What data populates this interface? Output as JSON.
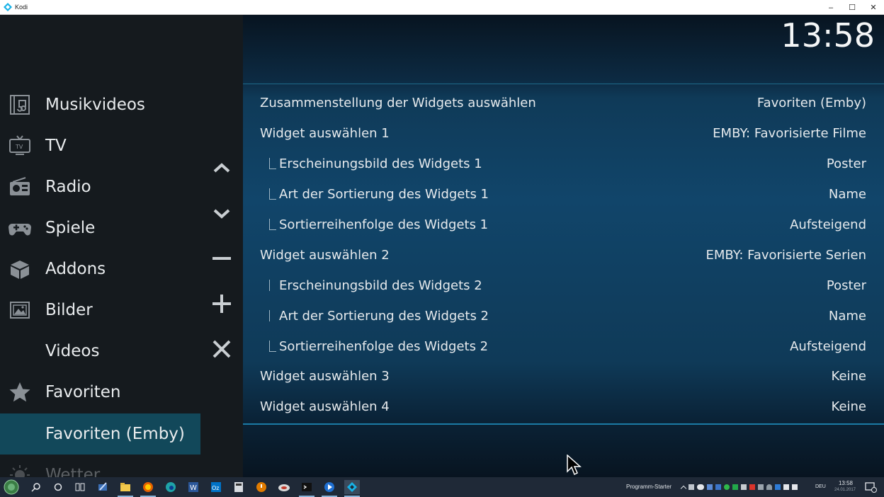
{
  "window": {
    "title": "Kodi",
    "minimize": "–",
    "maximize": "☐",
    "close": "✕"
  },
  "clock": "13:58",
  "sidebar": {
    "items": [
      {
        "label": "Musikvideos",
        "icon": "music-video-icon"
      },
      {
        "label": "TV",
        "icon": "tv-icon"
      },
      {
        "label": "Radio",
        "icon": "radio-icon"
      },
      {
        "label": "Spiele",
        "icon": "gamepad-icon"
      },
      {
        "label": "Addons",
        "icon": "addons-box-icon"
      },
      {
        "label": "Bilder",
        "icon": "pictures-icon"
      },
      {
        "label": "Videos",
        "icon": ""
      },
      {
        "label": "Favoriten",
        "icon": "star-icon"
      },
      {
        "label": "Favoriten (Emby)",
        "icon": ""
      },
      {
        "label": "Wetter",
        "icon": "weather-icon"
      }
    ],
    "active_index": 8
  },
  "side_controls": [
    "move-up",
    "move-down",
    "remove",
    "add",
    "close"
  ],
  "settings": {
    "rows": [
      {
        "label": "Zusammenstellung der Widgets auswählen",
        "value": "Favoriten (Emby)",
        "level": 0
      },
      {
        "label": "Widget auswählen 1",
        "value": "EMBY: Favorisierte Filme",
        "level": 0
      },
      {
        "label": "Erscheinungsbild des Widgets 1",
        "value": "Poster",
        "level": 1
      },
      {
        "label": "Art der Sortierung des Widgets 1",
        "value": "Name",
        "level": 1
      },
      {
        "label": "Sortierreihenfolge des Widgets 1",
        "value": "Aufsteigend",
        "level": 1
      },
      {
        "label": "Widget auswählen 2",
        "value": "EMBY: Favorisierte Serien",
        "level": 0
      },
      {
        "label": "Erscheinungsbild des Widgets 2",
        "value": "Poster",
        "level": 1
      },
      {
        "label": "Art der Sortierung des Widgets 2",
        "value": "Name",
        "level": 1
      },
      {
        "label": "Sortierreihenfolge des Widgets 2",
        "value": "Aufsteigend",
        "level": 1
      },
      {
        "label": "Widget auswählen 3",
        "value": "Keine",
        "level": 0
      },
      {
        "label": "Widget auswählen 4",
        "value": "Keine",
        "level": 0
      }
    ]
  },
  "taskbar": {
    "starter": "Programm-Starter",
    "lang": "DEU",
    "time": "13:58",
    "date": "24.01.2017"
  },
  "colors": {
    "sidebar_bg": "#151a1e",
    "active_item": "#12485a",
    "main_accent": "#1b7aa6"
  }
}
